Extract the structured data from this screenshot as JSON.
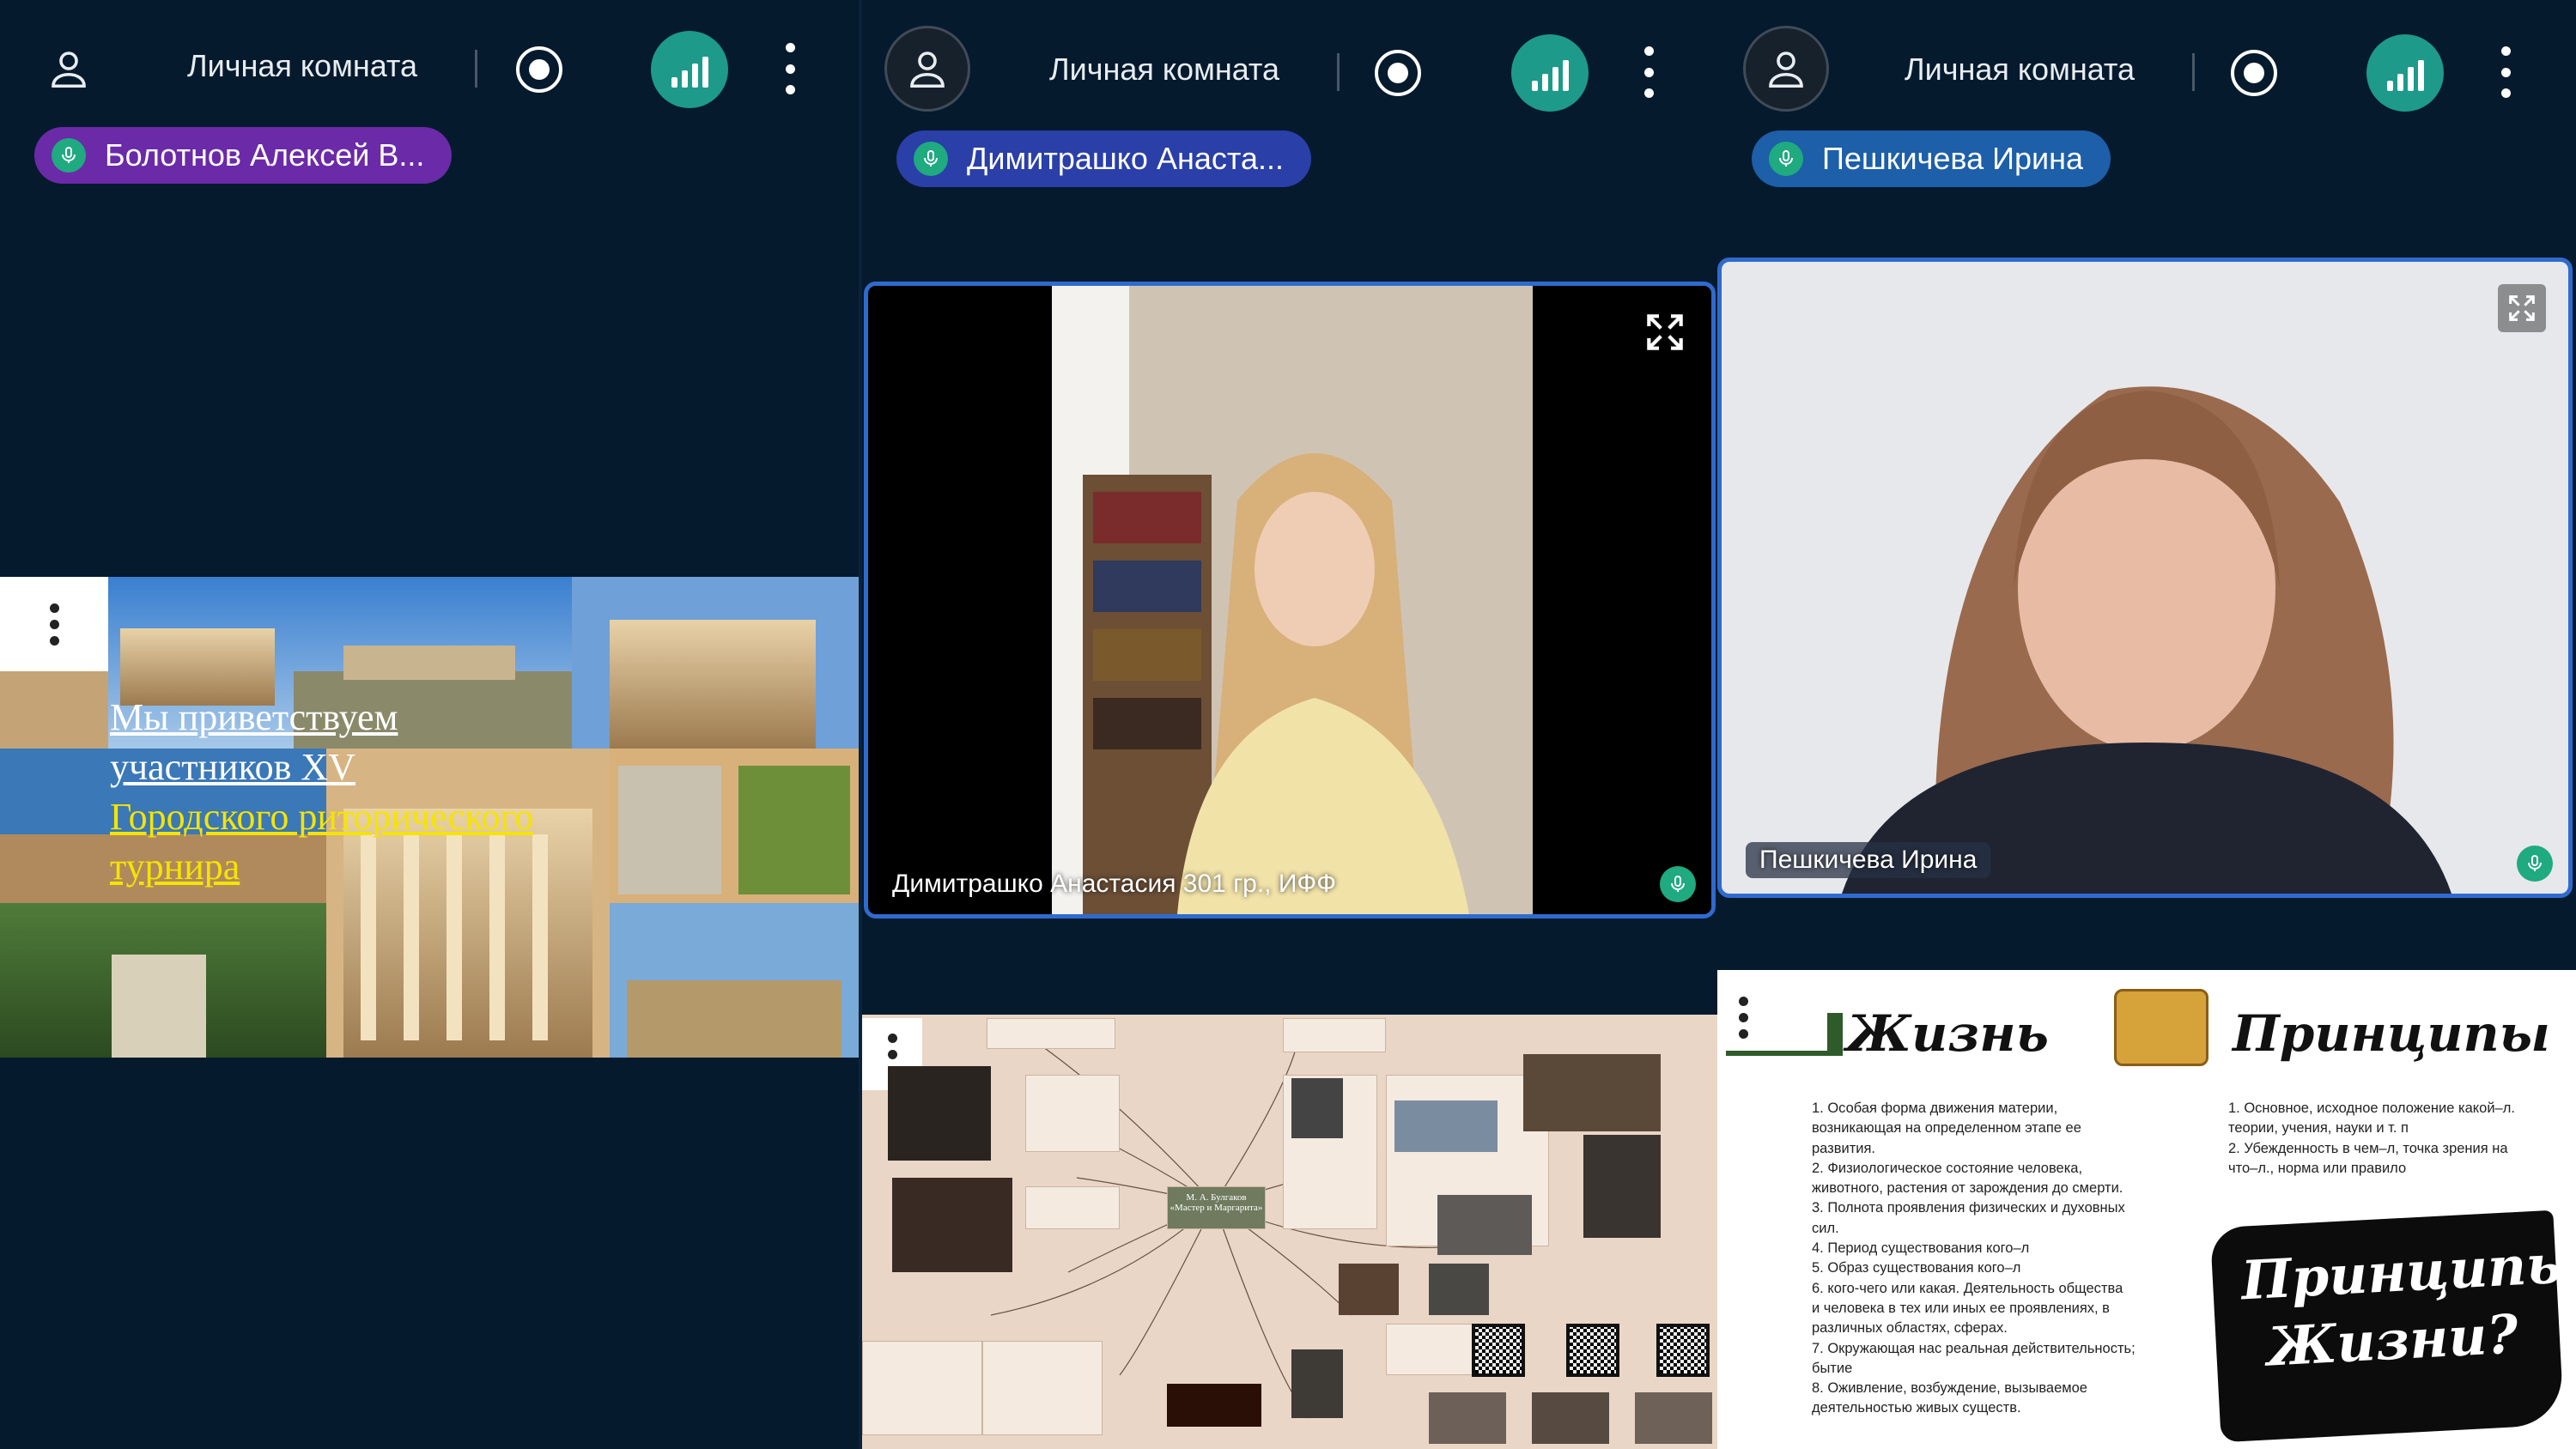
{
  "accent": {
    "signal": "#1d9a8a",
    "mic": "#1faa80",
    "active_border": "#2f6bcf",
    "chip1": "#6b2aa8",
    "chip2": "#2a3fa8",
    "chip3": "#1d5fa8"
  },
  "panels": [
    {
      "room": "Личная комната",
      "participant": "Болотнов Алексей В..."
    },
    {
      "room": "Личная комната",
      "participant": "Димитрашко Анаста..."
    },
    {
      "room": "Личная комната",
      "participant": "Пешкичева Ирина"
    }
  ],
  "welcome_slide": {
    "line1": "Мы приветствуем",
    "line2": "участников XV",
    "line3": "Городского риторического",
    "line4": "турнира"
  },
  "videos": [
    {
      "name": "Димитрашко Анастасия 301 гр., ИФФ"
    },
    {
      "name": "Пешкичева Ирина"
    }
  ],
  "mindmap": {
    "center": "М. А. Булгаков «Мастер и Маргарита»"
  },
  "principles_slide": {
    "title_left": "Жизнь",
    "title_right": "Принципы",
    "left_items": [
      "1. Особая форма движения материи,",
      "возникающая на определенном этапе ее",
      "развития.",
      "2. Физиологическое состояние человека,",
      "животного, растения от зарождения до смерти.",
      "3. Полнота проявления физических и духовных",
      "сил.",
      "4. Период существования кого–л",
      "5. Образ существования кого–л",
      "6. кого-чего или какая. Деятельность общества",
      "и человека в тех или иных ее проявлениях, в",
      "различных областях, сферах.",
      "7. Окружающая нас реальная действительность;",
      "бытие",
      "8. Оживление, возбуждение, вызываемое",
      "деятельностью живых существ."
    ],
    "right_items": [
      "1. Основное, исходное положение какой–л.",
      "теории, учения, науки и т. п",
      "2. Убежденность в чем–л, точка зрения на",
      "что–л., норма или правило"
    ],
    "banner_line1": "Принципы",
    "banner_line2": "Жизни?"
  }
}
